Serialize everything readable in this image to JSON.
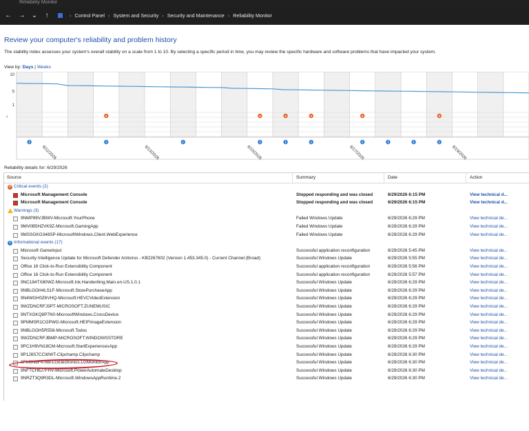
{
  "window": {
    "title_partial": "Reliability Monitor"
  },
  "address_bar": {
    "back_icon": "←",
    "forward_icon": "→",
    "recent_icon": "⌄",
    "up_icon": "↑",
    "breadcrumb": [
      "Control Panel",
      "System and Security",
      "Security and Maintenance",
      "Reliability Monitor"
    ],
    "separator": "›"
  },
  "page": {
    "heading": "Review your computer's reliability and problem history",
    "description": "The stability index assesses your system's overall stability on a scale from 1 to 10. By selecting a specific period in time, you may review the specific hardware and software problems that have impacted your system.",
    "view_by_label": "View by:",
    "view_days": "Days",
    "view_sep": "|",
    "view_weeks": "Weeks",
    "details_label": "Reliability details for: 6/29/2026"
  },
  "chart_data": {
    "type": "line",
    "ylim": [
      1,
      10
    ],
    "yticks": [
      "10",
      "5",
      "1"
    ],
    "x_labels": [
      "6/11/2026",
      "6/13/2026",
      "6/15/2026",
      "6/17/2026",
      "6/19/2026",
      "6/21/2026"
    ],
    "stability_index": [
      7.4,
      7.35,
      7.3,
      7.25,
      7.2,
      6.7,
      6.68,
      6.64,
      6.6,
      6.56,
      6.52,
      6.48,
      6.44,
      6.4,
      6.36,
      6.32,
      6.28,
      6.24,
      6.2,
      6.16,
      6.12,
      5.9,
      5.86,
      5.82,
      5.78,
      5.74,
      5.5,
      5.46,
      5.42,
      5.38,
      5.34,
      5.3,
      5.26,
      5.22,
      5.18,
      5.14,
      5.1,
      5.06,
      5.02,
      4.98,
      4.94,
      4.9,
      4.86,
      4.82,
      4.78,
      4.74,
      4.7,
      4.66,
      4.62,
      4.58,
      4.54
    ],
    "critical_markers": [
      3,
      9,
      10,
      11,
      13,
      16
    ],
    "info_markers": [
      0,
      3,
      6,
      9,
      10,
      11,
      13,
      14,
      15,
      16
    ],
    "line_color": "#4a9ad4"
  },
  "table": {
    "headers": {
      "source": "Source",
      "summary": "Summary",
      "date": "Date",
      "action": "Action"
    },
    "groups": [
      {
        "label": "Critical events (2)",
        "type": "crit",
        "rows": [
          {
            "source": "Microsoft Management Console",
            "summary": "Stopped responding and was closed",
            "date": "6/29/2026 6:15 PM",
            "action": "View technical d...",
            "bold": true
          },
          {
            "source": "Microsoft Management Console",
            "summary": "Stopped responding and was closed",
            "date": "6/29/2026 6:15 PM",
            "action": "View technical d...",
            "bold": true
          }
        ]
      },
      {
        "label": "Warnings (3)",
        "type": "warn",
        "rows": [
          {
            "source": "9NMP99VJBWV-Microsoft.YourPhone",
            "summary": "Failed Windows Update",
            "date": "6/29/2026 6:29 PM",
            "action": "View technical de...",
            "bold": false
          },
          {
            "source": "9MV0B5HZVK9Z-Microsoft.GamingApp",
            "summary": "Failed Windows Update",
            "date": "6/29/2026 6:29 PM",
            "action": "View technical de...",
            "bold": false
          },
          {
            "source": "9MSSGKG348SP-MicrosoftWindows.Client.WebExperience",
            "summary": "Failed Windows Update",
            "date": "6/29/2026 6:29 PM",
            "action": "View technical de...",
            "bold": false
          }
        ]
      },
      {
        "label": "Informational events (17)",
        "type": "info",
        "rows": [
          {
            "source": "Microsoft GameInput",
            "summary": "Successful application reconfiguration",
            "date": "6/29/2026 5:45 PM",
            "action": "View technical de...",
            "bold": false
          },
          {
            "source": "Security Intelligence Update for Microsoft Defender Antivirus - KB2267602 (Version 1.453.345.0) - Current Channel (Broad)",
            "summary": "Successful Windows Update",
            "date": "6/29/2026 5:55 PM",
            "action": "View technical de...",
            "bold": false
          },
          {
            "source": "Office 16 Click-to-Run Extensibility Component",
            "summary": "Successful application reconfiguration",
            "date": "6/29/2026 5:56 PM",
            "action": "View technical de...",
            "bold": false
          },
          {
            "source": "Office 16 Click-to-Run Extensibility Component",
            "summary": "Successful application reconfiguration",
            "date": "6/29/2026 5:57 PM",
            "action": "View technical de...",
            "bold": false
          },
          {
            "source": "9NC184TX80WZ-Microsoft.Ink.Handwriting.Main.en-US.1.0.1",
            "summary": "Successful Windows Update",
            "date": "6/29/2026 6:29 PM",
            "action": "View technical de...",
            "bold": false
          },
          {
            "source": "9NBLGGH4LS1F-Microsoft.StorePurchaseApp",
            "summary": "Successful Windows Update",
            "date": "6/29/2026 6:29 PM",
            "action": "View technical de...",
            "bold": false
          },
          {
            "source": "9N4WGH0Z6VHQ-Microsoft.HEVCVideoExtension",
            "summary": "Successful Windows Update",
            "date": "6/29/2026 6:29 PM",
            "action": "View technical de...",
            "bold": false
          },
          {
            "source": "9WZDNCRFJ3PT-MICROSOFT.ZUNEMUSIC",
            "summary": "Successful Windows Update",
            "date": "6/29/2026 6:29 PM",
            "action": "View technical de...",
            "bold": false
          },
          {
            "source": "9NTXGKQ8P7N0-MicrosoftWindows.CrossDevice",
            "summary": "Successful Windows Update",
            "date": "6/29/2026 6:29 PM",
            "action": "View technical de...",
            "bold": false
          },
          {
            "source": "9PMMSR1CGPWG-Microsoft.HEIFImageExtension",
            "summary": "Successful Windows Update",
            "date": "6/29/2026 6:29 PM",
            "action": "View technical de...",
            "bold": false
          },
          {
            "source": "9NBLGGH5R558-Microsoft.Todos",
            "summary": "Successful Windows Update",
            "date": "6/29/2026 6:29 PM",
            "action": "View technical de...",
            "bold": false
          },
          {
            "source": "9WZDNCRFJBMP-MICROSOFT.WINDOWSSTORE",
            "summary": "Successful Windows Update",
            "date": "6/29/2026 6:29 PM",
            "action": "View technical de...",
            "bold": false
          },
          {
            "source": "9PC1H9VN18CM-Microsoft.StartExperiencesApp",
            "summary": "Successful Windows Update",
            "date": "6/29/2026 6:29 PM",
            "action": "View technical de...",
            "bold": false
          },
          {
            "source": "9P1J8S7CCWWT-Clipchamp.Clipchamp",
            "summary": "Successful Windows Update",
            "date": "6/29/2026 6:30 PM",
            "action": "View technical de...",
            "bold": false
          },
          {
            "source": "9PM9N6F47B8-LGElectronics.LGMonitorApp",
            "summary": "Successful Windows Update",
            "date": "6/29/2026 6:30 PM",
            "action": "View technical de...",
            "bold": false
          },
          {
            "source": "9NFTCH6J7FHV-Microsoft.PowerAutomateDesktop",
            "summary": "Successful Windows Update",
            "date": "6/29/2026 6:30 PM",
            "action": "View technical de...",
            "bold": false
          },
          {
            "source": "9NRZT3Q9R3DL-Microsoft.WindowsAppRuntime.2",
            "summary": "Successful Windows Update",
            "date": "6/29/2026 6:30 PM",
            "action": "View technical de...",
            "bold": false
          }
        ]
      }
    ]
  },
  "colors": {
    "accent_link": "#1e4fa8",
    "annotation_red": "#cc1f2a",
    "critical": "#e0622a",
    "info": "#2d7fd1",
    "warning": "#f2b51d"
  }
}
